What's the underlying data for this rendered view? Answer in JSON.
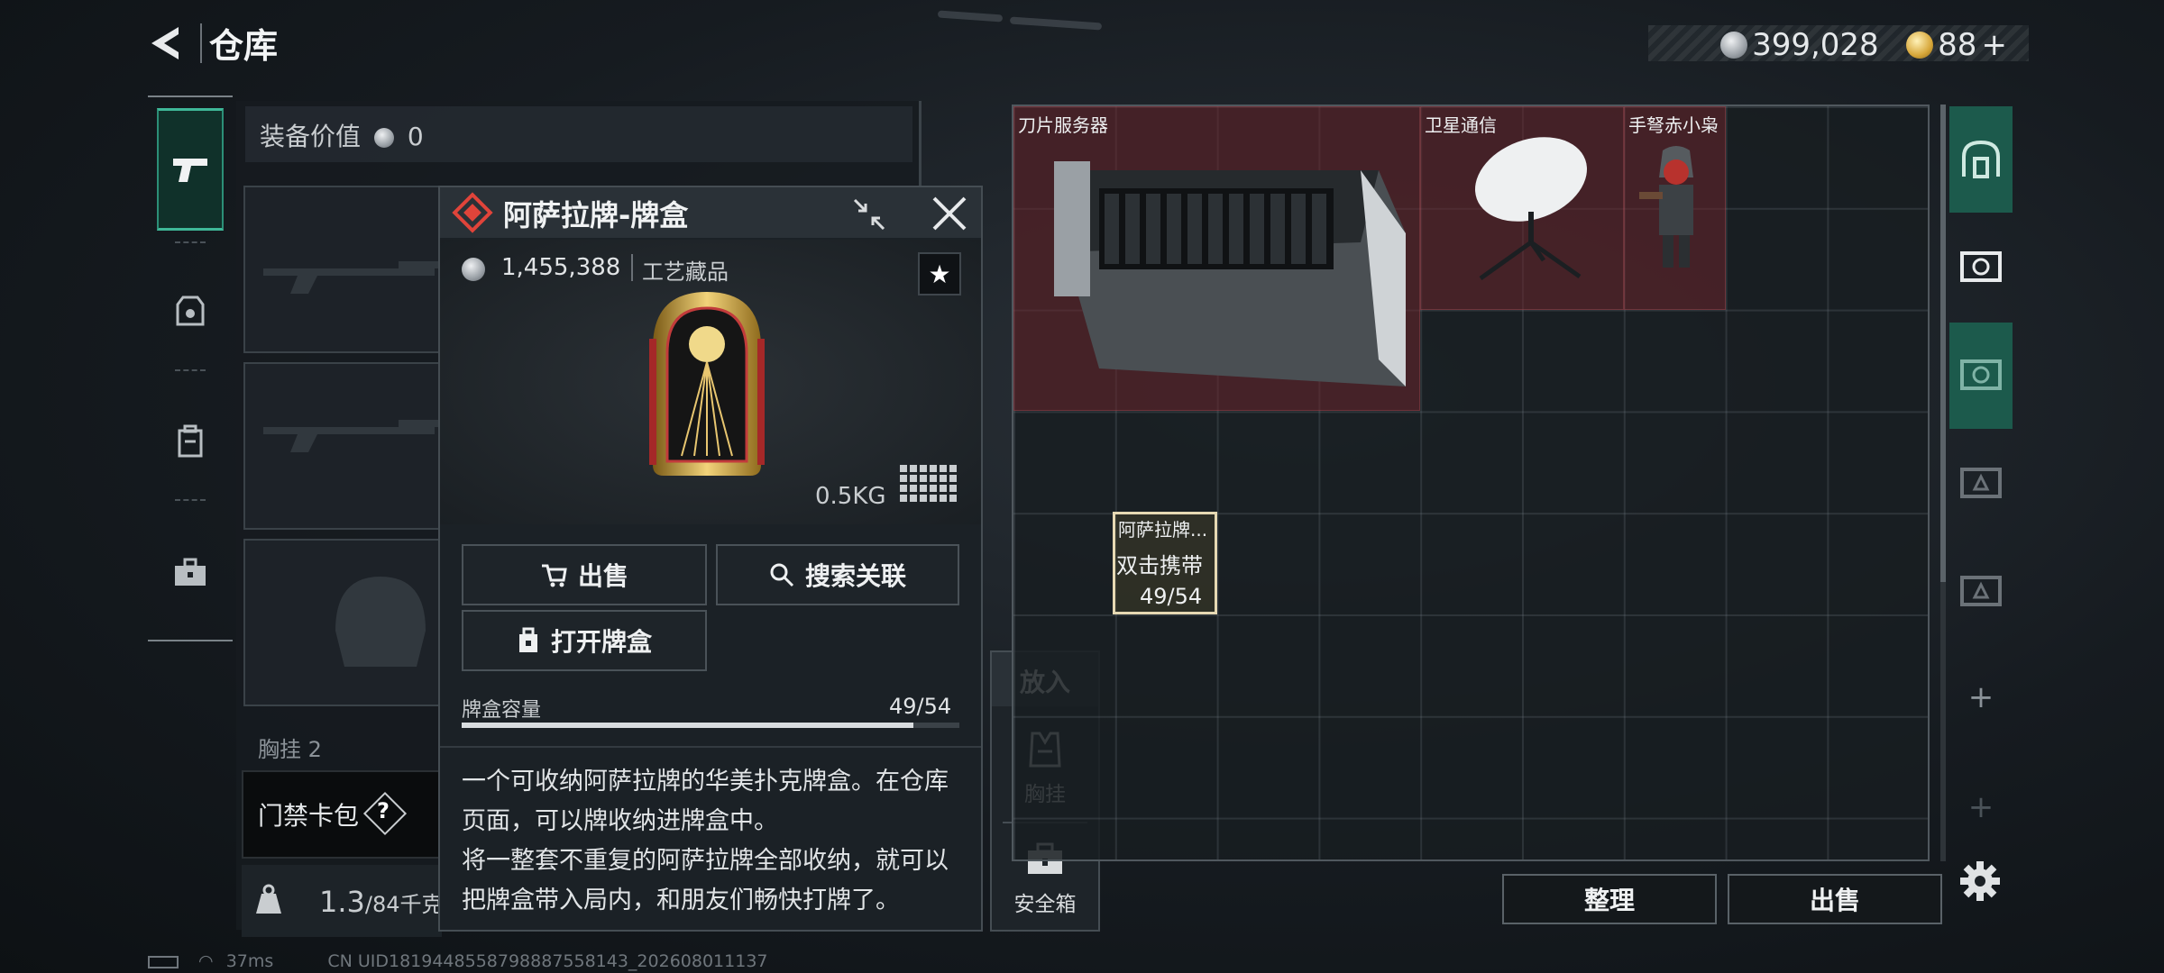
{
  "header": {
    "title": "仓库"
  },
  "currency": {
    "silver": "399,028",
    "gold": "88",
    "gold_plus": "+"
  },
  "equipment": {
    "value_label": "装备价值",
    "value": "0",
    "chest_slot_label": "胸挂",
    "chest_slot_count": "2",
    "keycard_label": "门禁卡包",
    "help": "?",
    "weight": "1.3",
    "weight_max": "/84千克"
  },
  "popup": {
    "title": "阿萨拉牌-牌盒",
    "price": "1,455,388",
    "category": "工艺藏品",
    "star": "★",
    "weight": "0.5KG",
    "sell_label": "出售",
    "search_label": "搜索关联",
    "open_label": "打开牌盒",
    "capacity_label": "牌盒容量",
    "capacity_value": "49/54",
    "capacity_fraction": 0.907,
    "description": "一个可收纳阿萨拉牌的华美扑克牌盒。在仓库页面，可以牌收纳进牌盒中。\n将一整套不重复的阿萨拉牌全部收纳，就可以把牌盒带入局内，和朋友们畅快打牌了。"
  },
  "putin": {
    "title": "放入",
    "items": [
      {
        "label": "胸挂",
        "icon": "chest-rig-icon"
      },
      {
        "label": "安全箱",
        "icon": "safe-box-icon"
      }
    ]
  },
  "stash": {
    "items": [
      {
        "label": "刀片服务器"
      },
      {
        "label": "卫星通信"
      },
      {
        "label": "手弩赤小枭"
      }
    ],
    "selected": {
      "label": "阿萨拉牌...",
      "hint": "双击携带",
      "count": "49/54"
    }
  },
  "bottom": {
    "sort_label": "整理",
    "sell_label": "出售"
  },
  "status": {
    "ping": "37ms",
    "uid": "CN UID1819448558798887558143_202608011137"
  },
  "colors": {
    "accent_green": "#1c5a4c",
    "highlight_red": "#69242c",
    "title_red": "#e0443a"
  }
}
